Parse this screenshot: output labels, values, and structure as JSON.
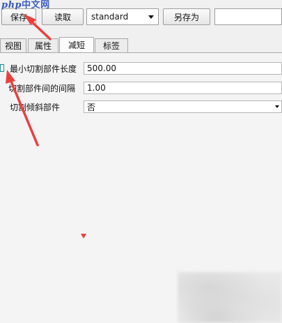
{
  "toolbar": {
    "save_label": "保存",
    "load_label": "读取",
    "preset_value": "standard",
    "save_as_label": "另存为",
    "search_value": ""
  },
  "watermark": {
    "php": "php",
    "text": "中文网"
  },
  "tabs": [
    {
      "label": "视图",
      "active": false
    },
    {
      "label": "属性",
      "active": false
    },
    {
      "label": "减短",
      "active": true
    },
    {
      "label": "标签",
      "active": false
    }
  ],
  "form": {
    "min_part_length": {
      "label": "最小切割部件长度",
      "value": "500.00"
    },
    "part_gap": {
      "label": "切割部件间的间隔",
      "value": "1.00"
    },
    "tilt_parts": {
      "label": "切割倾斜部件",
      "value": "否"
    }
  },
  "colors": {
    "annotation_arrow": "#e8403f",
    "watermark_blue": "#3b5fc1",
    "checkbox_border": "#1d8a94"
  }
}
